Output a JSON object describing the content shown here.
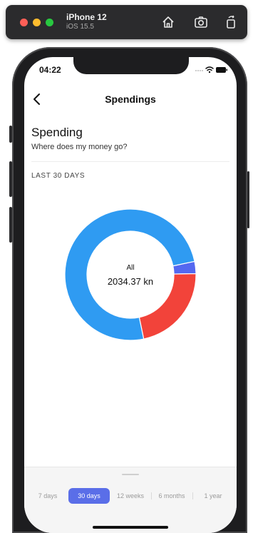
{
  "simulator": {
    "device": "iPhone 12",
    "os": "iOS 15.5",
    "icons": [
      "home-icon",
      "screenshot-icon",
      "rotate-icon"
    ]
  },
  "status_bar": {
    "time": "04:22"
  },
  "nav": {
    "title": "Spendings",
    "back_icon": "chevron-left-icon"
  },
  "header": {
    "title": "Spending",
    "subtitle": "Where does my money go?"
  },
  "section_label": "LAST 30 DAYS",
  "chart_data": {
    "type": "pie",
    "donut": true,
    "center_label": "All",
    "center_value": "2034.37 kn",
    "slices": [
      {
        "value": 0.03,
        "color": "#5468f0"
      },
      {
        "value": 0.22,
        "color": "#f2433a"
      },
      {
        "value": 0.75,
        "color": "#2f9bf2"
      }
    ]
  },
  "range_selector": {
    "options": [
      "7 days",
      "30 days",
      "12 weeks",
      "6 months",
      "1 year"
    ],
    "selected": "30 days"
  },
  "colors": {
    "accent": "#5a6ee8",
    "blue": "#2f9bf2",
    "red": "#f2433a",
    "indigo": "#5468f0"
  }
}
